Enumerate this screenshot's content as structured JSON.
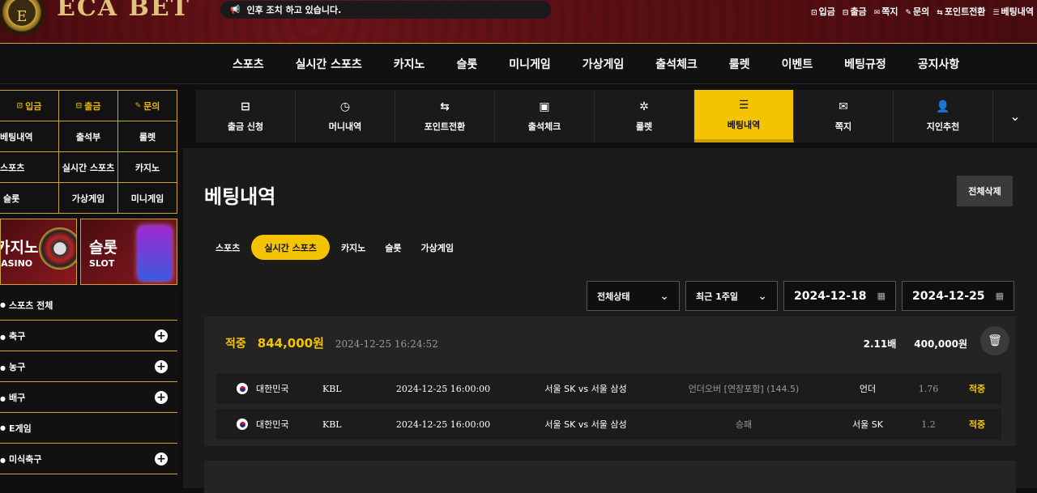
{
  "logo": {
    "emblem": "E",
    "text": "ECA BET"
  },
  "notice": {
    "icon": "megaphone-icon",
    "text": "인후 조치 하고 있습니다."
  },
  "toplinks": [
    {
      "icon": "deposit-icon",
      "label": "입금"
    },
    {
      "icon": "withdraw-icon",
      "label": "출금"
    },
    {
      "icon": "mail-icon",
      "label": "쪽지"
    },
    {
      "icon": "question-icon",
      "label": "문의"
    },
    {
      "icon": "exchange-icon",
      "label": "포인트전환"
    },
    {
      "icon": "list-icon",
      "label": "베팅내역"
    }
  ],
  "mainnav": [
    "스포츠",
    "실시간 스포츠",
    "카지노",
    "슬롯",
    "미니게임",
    "가상게임",
    "출석체크",
    "룰렛",
    "이벤트",
    "베팅규정",
    "공지사항"
  ],
  "sidebar": {
    "grid": [
      {
        "label": "입금",
        "accent": true
      },
      {
        "label": "출금",
        "accent": true
      },
      {
        "label": "문의",
        "accent": true
      },
      {
        "label": "베팅내역"
      },
      {
        "label": "출석부"
      },
      {
        "label": "룰렛"
      },
      {
        "label": "스포츠"
      },
      {
        "label": "실시간 스포츠"
      },
      {
        "label": "카지노"
      },
      {
        "label": "슬롯"
      },
      {
        "label": "가상게임"
      },
      {
        "label": "미니게임"
      }
    ],
    "banners": [
      {
        "title": "카지노",
        "sub": "CASINO"
      },
      {
        "title": "슬롯",
        "sub": "SLOT"
      }
    ],
    "sports": [
      {
        "label": "스포츠 전체",
        "expand": false
      },
      {
        "label": "축구",
        "expand": true
      },
      {
        "label": "농구",
        "expand": true
      },
      {
        "label": "배구",
        "expand": true
      },
      {
        "label": "E게임",
        "expand": false
      },
      {
        "label": "미식축구",
        "expand": true
      }
    ]
  },
  "quick": [
    {
      "icon": "cash-icon",
      "glyph": "⊟",
      "label": "출금 신청"
    },
    {
      "icon": "clock-icon",
      "glyph": "◷",
      "label": "머니내역"
    },
    {
      "icon": "exchange-icon",
      "glyph": "⇆",
      "label": "포인트전환"
    },
    {
      "icon": "calendar-check-icon",
      "glyph": "▣",
      "label": "출석체크"
    },
    {
      "icon": "roulette-icon",
      "glyph": "✲",
      "label": "룰렛"
    },
    {
      "icon": "list-icon",
      "glyph": "☰",
      "label": "베팅내역",
      "active": true
    },
    {
      "icon": "mail-icon",
      "glyph": "✉",
      "label": "쪽지"
    },
    {
      "icon": "user-add-icon",
      "glyph": "👤",
      "label": "지인추천"
    }
  ],
  "page": {
    "title": "베팅내역",
    "delete_all": "전체삭제"
  },
  "tabs": [
    {
      "label": "스포츠"
    },
    {
      "label": "실시간 스포츠",
      "active": true
    },
    {
      "label": "카지노"
    },
    {
      "label": "슬롯"
    },
    {
      "label": "가상게임"
    }
  ],
  "filters": {
    "status": "전체상태",
    "period": "최근 1주일",
    "date_from": "2024-12-18",
    "date_to": "2024-12-25"
  },
  "bet": {
    "result": "적중",
    "amount": "844,000원",
    "timestamp": "2024-12-25 16:24:52",
    "odds": "2.11배",
    "stake": "400,000원",
    "rows": [
      {
        "country": "대한민국",
        "league": "KBL",
        "time": "2024-12-25 16:00:00",
        "match": "서울 SK vs 서울 삼성",
        "market": "언더오버 [연장포함] (144.5)",
        "pick": "언더",
        "odds": "1.76",
        "result": "적중"
      },
      {
        "country": "대한민국",
        "league": "KBL",
        "time": "2024-12-25 16:00:00",
        "match": "서울 SK vs 서울 삼성",
        "market": "승패",
        "pick": "서울 SK",
        "odds": "1.2",
        "result": "적중"
      }
    ]
  }
}
